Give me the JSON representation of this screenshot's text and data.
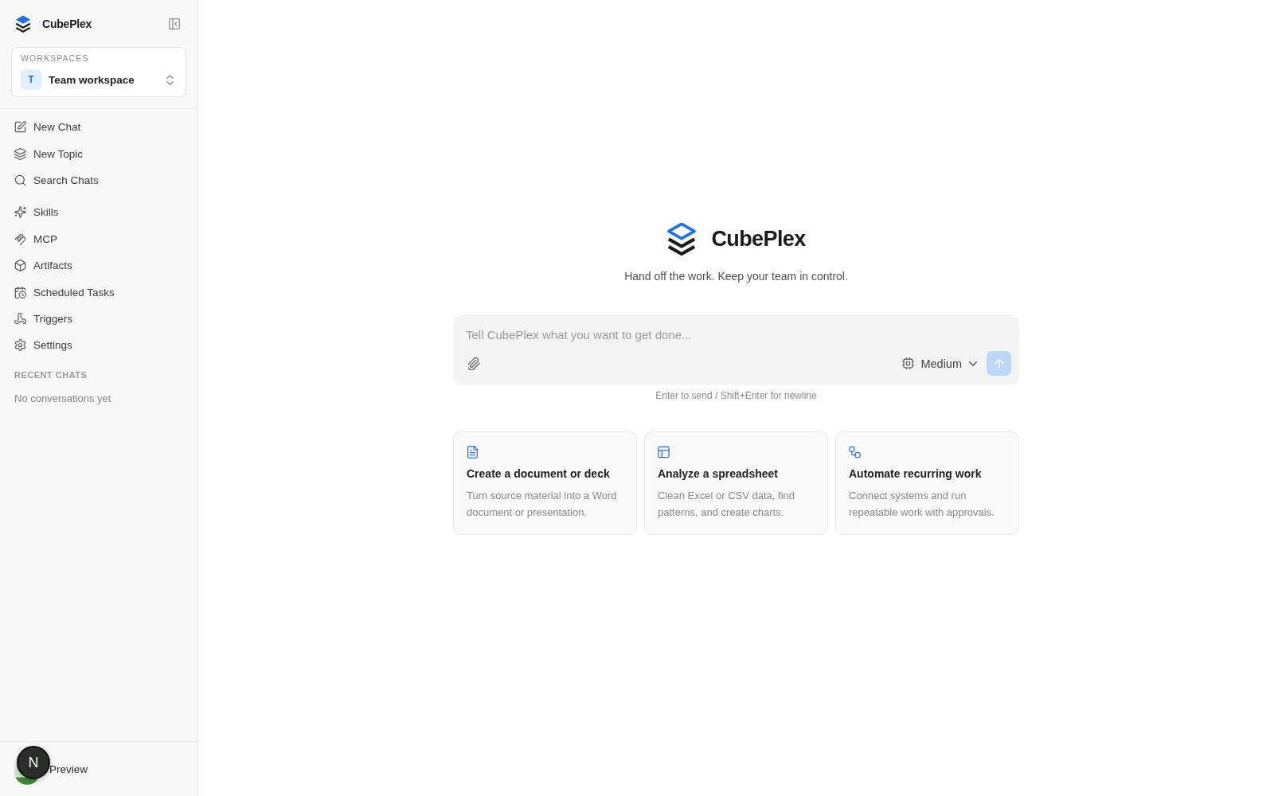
{
  "sidebar": {
    "brand": {
      "name": "CubePlex"
    },
    "workspace": {
      "label": "WORKSPACES",
      "initial": "T",
      "name": "Team workspace"
    },
    "actions": [
      {
        "label": "New Chat"
      },
      {
        "label": "New Topic"
      },
      {
        "label": "Search Chats"
      }
    ],
    "tools": [
      {
        "label": "Skills"
      },
      {
        "label": "MCP"
      },
      {
        "label": "Artifacts"
      },
      {
        "label": "Scheduled Tasks"
      },
      {
        "label": "Triggers"
      },
      {
        "label": "Settings"
      }
    ],
    "recent_chats": {
      "heading": "RECENT CHATS",
      "empty_text": "No conversations yet"
    },
    "footer": {
      "dev_badge": "N",
      "label": "Preview"
    }
  },
  "main": {
    "brand": {
      "name": "CubePlex"
    },
    "tagline": "Hand off the work. Keep your team in control.",
    "composer": {
      "placeholder": "Tell CubePlex what you want to get done...",
      "effort": "Medium",
      "send_disabled": true
    },
    "hint": "Enter to send / Shift+Enter for newline",
    "cards": [
      {
        "title": "Create a document or deck",
        "description": "Turn source material into a Word document or presentation."
      },
      {
        "title": "Analyze a spreadsheet",
        "description": "Clean Excel or CSV data, find patterns, and create charts."
      },
      {
        "title": "Automate recurring work",
        "description": "Connect systems and run repeatable work with approvals."
      }
    ]
  }
}
